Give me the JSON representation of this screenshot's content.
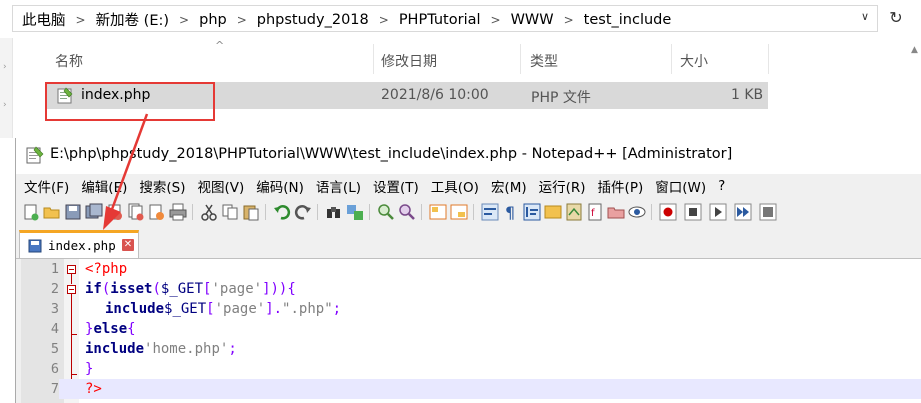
{
  "explorer": {
    "breadcrumb": [
      "此电脑",
      "新加卷 (E:)",
      "php",
      "phpstudy_2018",
      "PHPTutorial",
      "WWW",
      "test_include"
    ],
    "columns": {
      "name": "名称",
      "date": "修改日期",
      "type": "类型",
      "size": "大小"
    },
    "file": {
      "name": "index.php",
      "date": "2021/8/6 10:00",
      "type": "PHP 文件",
      "size": "1 KB"
    }
  },
  "notepad": {
    "title": "E:\\php\\phpstudy_2018\\PHPTutorial\\WWW\\test_include\\index.php - Notepad++ [Administrator]",
    "menu": [
      "文件(F)",
      "编辑(E)",
      "搜索(S)",
      "视图(V)",
      "编码(N)",
      "语言(L)",
      "设置(T)",
      "工具(O)",
      "宏(M)",
      "运行(R)",
      "插件(P)",
      "窗口(W)",
      "?"
    ],
    "tab": {
      "label": "index.php",
      "close": "✕"
    },
    "line_numbers": [
      "1",
      "2",
      "3",
      "4",
      "5",
      "6",
      "7"
    ],
    "code": {
      "l1_open": "<?php",
      "l2_if": "if",
      "l2_paren_open": "(",
      "l2_isset": "isset",
      "l2_paren2": "(",
      "l2_var": "$_GET",
      "l2_br1": "[",
      "l2_str": "'page'",
      "l2_br2": "]))",
      "l2_brace": "{",
      "l3_include": "include",
      "l3_var": "$_GET",
      "l3_br1": "[",
      "l3_str1": "'page'",
      "l3_br2": "].",
      "l3_str2": "\".php\"",
      "l3_semi": ";",
      "l4_close": "}",
      "l4_else": "else",
      "l4_brace": "{",
      "l5_include": "include",
      "l5_str": "'home.php'",
      "l5_semi": ";",
      "l6_close": "}",
      "l7_close": "?>"
    }
  },
  "colors": {
    "highlight_box": "#e53935",
    "tab_accent": "#f5a623",
    "keyword": "#000080",
    "php_tag": "#ff0000",
    "string": "#808080",
    "operator": "#8000ff"
  }
}
